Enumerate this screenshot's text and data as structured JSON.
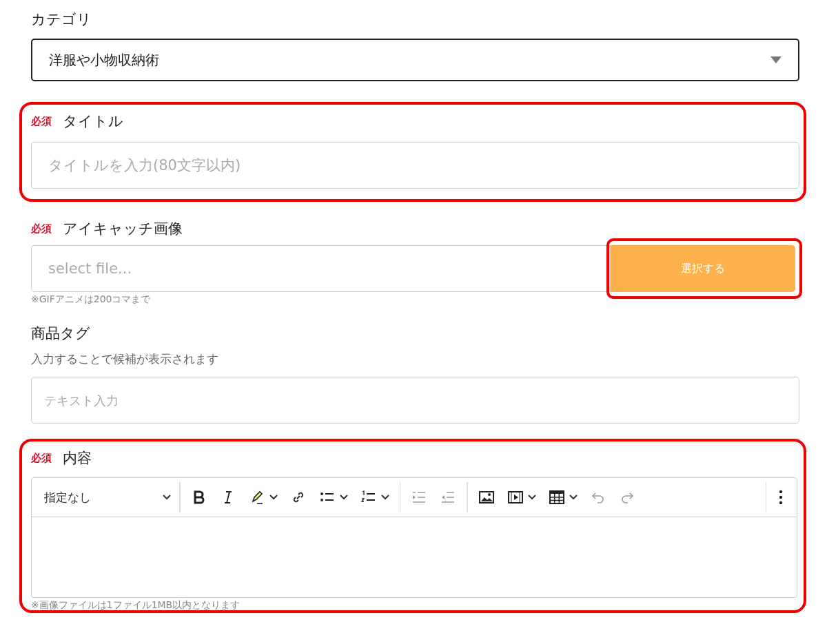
{
  "category": {
    "label": "カテゴリ",
    "value": "洋服や小物収納術"
  },
  "title": {
    "required": "必須",
    "label": "タイトル",
    "placeholder": "タイトルを入力(80文字以内)",
    "highlighted": true
  },
  "eyecatch": {
    "required": "必須",
    "label": "アイキャッチ画像",
    "placeholder": "select file...",
    "button": "選択する",
    "button_highlighted": true,
    "note": "※GIFアニメは200コマまで"
  },
  "tags": {
    "label": "商品タグ",
    "hint": "入力することで候補が表示されます",
    "placeholder": "テキスト入力"
  },
  "content": {
    "required": "必須",
    "label": "内容",
    "highlighted": true,
    "format": "指定なし",
    "note": "※画像ファイルは1ファイル1MB以内となります",
    "toolbar": [
      [
        {
          "kind": "bold",
          "disabled": false,
          "dropdown": false
        },
        {
          "kind": "italic",
          "disabled": false,
          "dropdown": false
        },
        {
          "kind": "highlight",
          "disabled": false,
          "dropdown": true
        },
        {
          "kind": "link",
          "disabled": false,
          "dropdown": false
        },
        {
          "kind": "bullets",
          "disabled": false,
          "dropdown": true
        },
        {
          "kind": "numbers",
          "disabled": false,
          "dropdown": true
        }
      ],
      [
        {
          "kind": "indent",
          "disabled": true,
          "dropdown": false
        },
        {
          "kind": "outdent",
          "disabled": true,
          "dropdown": false
        }
      ],
      [
        {
          "kind": "image",
          "disabled": false,
          "dropdown": false
        },
        {
          "kind": "video",
          "disabled": false,
          "dropdown": true
        },
        {
          "kind": "table",
          "disabled": false,
          "dropdown": true
        },
        {
          "kind": "undo",
          "disabled": true,
          "dropdown": false
        },
        {
          "kind": "redo",
          "disabled": true,
          "dropdown": false
        }
      ]
    ]
  }
}
